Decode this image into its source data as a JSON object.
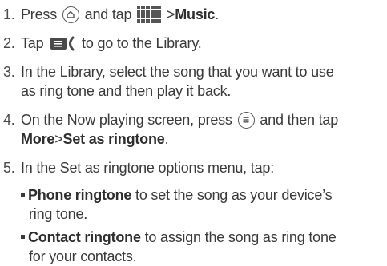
{
  "steps": [
    {
      "num": "1.",
      "t1": "Press",
      "t2": "and tap",
      "sep": ">",
      "music": "Music",
      "end": "."
    },
    {
      "num": "2.",
      "t1": "Tap",
      "t2": "to go to the Library."
    },
    {
      "num": "3.",
      "line1": "In the Library, select the song that you want to use",
      "line2": "as ring tone and then play it back."
    },
    {
      "num": "4.",
      "t1": "On the Now playing screen, press",
      "t2": "and then tap",
      "more": "More",
      "sep": ">",
      "set": "Set as ringtone",
      "end": "."
    },
    {
      "num": "5.",
      "text": "In the Set as ringtone options menu, tap:"
    }
  ],
  "options": [
    {
      "bold": "Phone ringtone",
      "line1": "to set the song as your device’s",
      "line2": "ring tone."
    },
    {
      "bold": "Contact ringtone",
      "line1": "to assign the song as ring tone",
      "line2": "for your contacts."
    }
  ],
  "icons": {
    "home": "home-icon",
    "all_apps": "all-apps-grid-icon",
    "library": "library-icon",
    "menu": "menu-icon"
  }
}
